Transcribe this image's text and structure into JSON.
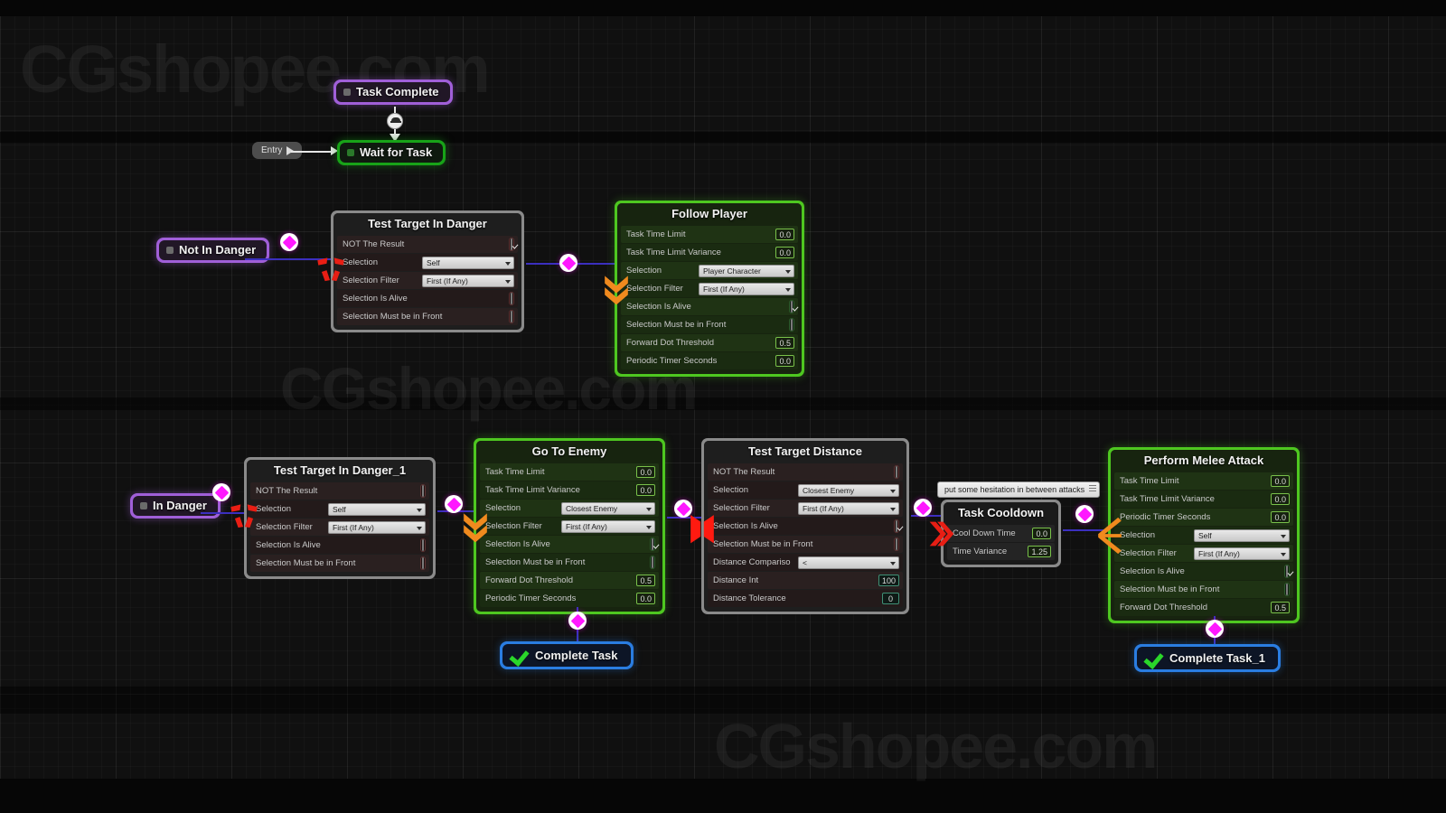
{
  "watermarks": [
    "CGshopee.com",
    "CGshopee.com",
    "CGshopee.com"
  ],
  "entry": {
    "label": "Entry"
  },
  "states": {
    "task_complete": "Task Complete",
    "wait_for_task": "Wait for Task",
    "not_in_danger": "Not In Danger",
    "in_danger": "In Danger",
    "complete_task": "Complete Task",
    "complete_task_1": "Complete Task_1"
  },
  "comment": {
    "text": "put some hesitation in between attacks"
  },
  "nodes": {
    "test_target_in_danger": {
      "title": "Test Target In Danger",
      "icon": "condition-red-icon",
      "rows": [
        {
          "label": "NOT The Result",
          "type": "checkbox",
          "value": true
        },
        {
          "label": "Selection",
          "type": "combo",
          "value": "Self"
        },
        {
          "label": "Selection Filter",
          "type": "combo",
          "value": "First (If Any)"
        },
        {
          "label": "Selection Is Alive",
          "type": "checkbox",
          "value": false
        },
        {
          "label": "Selection Must be in Front",
          "type": "checkbox",
          "value": false
        }
      ]
    },
    "follow_player": {
      "title": "Follow Player",
      "icon": "chevrons-down-orange-icon",
      "rows": [
        {
          "label": "Task Time Limit",
          "type": "number",
          "value": "0.0"
        },
        {
          "label": "Task Time Limit Variance",
          "type": "number",
          "value": "0.0"
        },
        {
          "label": "Selection",
          "type": "combo",
          "value": "Player Character"
        },
        {
          "label": "Selection Filter",
          "type": "combo",
          "value": "First (If Any)"
        },
        {
          "label": "Selection Is Alive",
          "type": "checkbox",
          "value": true
        },
        {
          "label": "Selection Must be in Front",
          "type": "checkbox",
          "value": false
        },
        {
          "label": "Forward Dot Threshold",
          "type": "number",
          "value": "0.5"
        },
        {
          "label": "Periodic Timer Seconds",
          "type": "number",
          "value": "0.0"
        }
      ]
    },
    "test_target_in_danger_1": {
      "title": "Test Target In Danger_1",
      "icon": "condition-red-icon",
      "rows": [
        {
          "label": "NOT The Result",
          "type": "checkbox",
          "value": false
        },
        {
          "label": "Selection",
          "type": "combo",
          "value": "Self"
        },
        {
          "label": "Selection Filter",
          "type": "combo",
          "value": "First (If Any)"
        },
        {
          "label": "Selection Is Alive",
          "type": "checkbox",
          "value": false
        },
        {
          "label": "Selection Must be in Front",
          "type": "checkbox",
          "value": false
        }
      ]
    },
    "go_to_enemy": {
      "title": "Go To Enemy",
      "icon": "chevrons-down-orange-icon",
      "rows": [
        {
          "label": "Task Time Limit",
          "type": "number",
          "value": "0.0"
        },
        {
          "label": "Task Time Limit Variance",
          "type": "number",
          "value": "0.0"
        },
        {
          "label": "Selection",
          "type": "combo",
          "value": "Closest Enemy"
        },
        {
          "label": "Selection Filter",
          "type": "combo",
          "value": "First (If Any)"
        },
        {
          "label": "Selection Is Alive",
          "type": "checkbox",
          "value": true
        },
        {
          "label": "Selection Must be in Front",
          "type": "checkbox",
          "value": false
        },
        {
          "label": "Forward Dot Threshold",
          "type": "number",
          "value": "0.5"
        },
        {
          "label": "Periodic Timer Seconds",
          "type": "number",
          "value": "0.0"
        }
      ]
    },
    "test_target_distance": {
      "title": "Test Target Distance",
      "icon": "distance-red-icon",
      "rows": [
        {
          "label": "NOT The Result",
          "type": "checkbox",
          "value": false
        },
        {
          "label": "Selection",
          "type": "combo",
          "value": "Closest Enemy"
        },
        {
          "label": "Selection Filter",
          "type": "combo",
          "value": "First (If Any)"
        },
        {
          "label": "Selection Is Alive",
          "type": "checkbox",
          "value": true
        },
        {
          "label": "Selection Must be in Front",
          "type": "checkbox",
          "value": false
        },
        {
          "label": "Distance Compariso",
          "type": "combo",
          "value": "<"
        },
        {
          "label": "Distance Int",
          "type": "number",
          "value": "100"
        },
        {
          "label": "Distance Tolerance",
          "type": "number",
          "value": "0"
        }
      ]
    },
    "task_cooldown": {
      "title": "Task Cooldown",
      "icon": "chevrons-right-red-icon",
      "rows": [
        {
          "label": "Cool Down Time",
          "type": "number",
          "value": "0.0"
        },
        {
          "label": "Time Variance",
          "type": "number",
          "value": "1.25"
        }
      ]
    },
    "perform_melee_attack": {
      "title": "Perform Melee Attack",
      "icon": "fork-orange-icon",
      "rows": [
        {
          "label": "Task Time Limit",
          "type": "number",
          "value": "0.0"
        },
        {
          "label": "Task Time Limit Variance",
          "type": "number",
          "value": "0.0"
        },
        {
          "label": "Periodic Timer Seconds",
          "type": "number",
          "value": "0.0"
        },
        {
          "label": "Selection",
          "type": "combo",
          "value": "Self"
        },
        {
          "label": "Selection Filter",
          "type": "combo",
          "value": "First (If Any)"
        },
        {
          "label": "Selection Is Alive",
          "type": "checkbox",
          "value": true
        },
        {
          "label": "Selection Must be in Front",
          "type": "checkbox",
          "value": false
        },
        {
          "label": "Forward Dot Threshold",
          "type": "number",
          "value": "0.5"
        }
      ]
    }
  },
  "colors": {
    "task_green": "#4ec720",
    "state_purple": "#a05fd8",
    "complete_blue": "#2a7de1",
    "pin_magenta": "#ff18ff",
    "wire_blue": "#3b2fbf",
    "icon_orange": "#f08a1e",
    "icon_red": "#e81e14"
  }
}
